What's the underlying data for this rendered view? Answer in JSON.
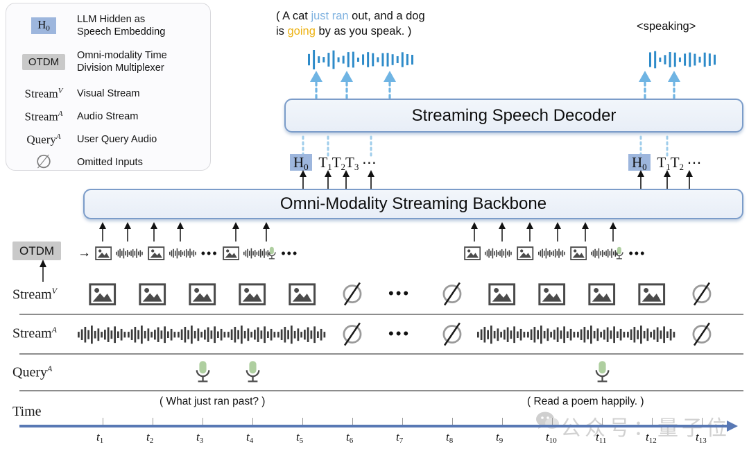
{
  "legend": {
    "items": [
      {
        "key": "H0",
        "key_type": "chip-h0",
        "label": "LLM Hidden as\nSpeech Embedding"
      },
      {
        "key": "OTDM",
        "key_type": "chip-otdm",
        "label": "Omni-modality Time\nDivision Multiplexer"
      },
      {
        "key": "Stream^V",
        "key_type": "serif",
        "label": "Visual Stream"
      },
      {
        "key": "Stream^A",
        "key_type": "serif",
        "label": "Audio Stream"
      },
      {
        "key": "Query^A",
        "key_type": "serif",
        "label": "User Query Audio"
      },
      {
        "key": "∅",
        "key_type": "nullglyph",
        "label": "Omitted Inputs"
      }
    ]
  },
  "output": {
    "left_caption_line1_pre": "( A cat ",
    "left_caption_blue": "just ran",
    "left_caption_line1_post": " out, and a dog",
    "left_caption_line2_pre": "is ",
    "left_caption_gold": "going",
    "left_caption_line2_post": " by as you speak. )",
    "right_caption": "<speaking>"
  },
  "decoder": {
    "title": "Streaming Speech Decoder"
  },
  "backbone": {
    "title": "Omni-Modality Streaming Backbone"
  },
  "tokens": {
    "left": {
      "h0": "H",
      "h0_sub": "0",
      "items": [
        {
          "t": "T",
          "s": "1"
        },
        {
          "t": "T",
          "s": "2"
        },
        {
          "t": "T",
          "s": "3"
        }
      ],
      "ellipsis": "⋯"
    },
    "right": {
      "h0": "H",
      "h0_sub": "0",
      "items": [
        {
          "t": "T",
          "s": "1"
        },
        {
          "t": "T",
          "s": "2"
        }
      ],
      "ellipsis": "⋯"
    }
  },
  "otdm": {
    "chip": "OTDM",
    "arrow": "→",
    "left_sequence": [
      "image",
      "audio",
      "image",
      "audio",
      "dots",
      "image",
      "audio",
      "mic",
      "dots"
    ],
    "right_sequence": [
      "image",
      "audio",
      "image",
      "audio",
      "image",
      "audio",
      "mic",
      "dots"
    ]
  },
  "rows": {
    "stream_v": {
      "label": "Stream",
      "sup": "V",
      "cells": [
        "image",
        "image",
        "image",
        "image",
        "image",
        "null",
        "dots",
        "null",
        "image",
        "image",
        "image",
        "image",
        "null"
      ]
    },
    "stream_a": {
      "label": "Stream",
      "sup": "A",
      "cells": [
        "audio",
        "audio",
        "audio",
        "audio",
        "audio",
        "null",
        "dots",
        "null",
        "audio",
        "audio",
        "audio",
        "audio",
        "null"
      ]
    },
    "query_a": {
      "label": "Query",
      "sup": "A",
      "cells": [
        "",
        "",
        "mic",
        "mic",
        "",
        "",
        "",
        "",
        "",
        "",
        "mic",
        "",
        ""
      ]
    },
    "time": {
      "label": "Time"
    }
  },
  "queries": {
    "left": "( What just ran past? )",
    "right": "( Read a poem happily. )"
  },
  "time_axis": {
    "ticks": [
      "t1",
      "t2",
      "t3",
      "t4",
      "t5",
      "t6",
      "t7",
      "t8",
      "t9",
      "t10",
      "t11",
      "t12",
      "t13"
    ],
    "tick_base": "t",
    "tick_subs": [
      "1",
      "2",
      "3",
      "4",
      "5",
      "6",
      "7",
      "8",
      "9",
      "10",
      "11",
      "12",
      "13"
    ]
  },
  "watermark": {
    "text": "公众号：量子位"
  },
  "colors": {
    "accent_blue": "#7b9cc9",
    "h0_chip": "#9db6dd",
    "otdm_chip": "#c9c9c9",
    "wave_blue": "#2e8bc9",
    "mic_green": "#afcfa0",
    "axis_blue": "#5878b4",
    "gold": "#edb211",
    "light_blue_text": "#7fb2e0"
  }
}
